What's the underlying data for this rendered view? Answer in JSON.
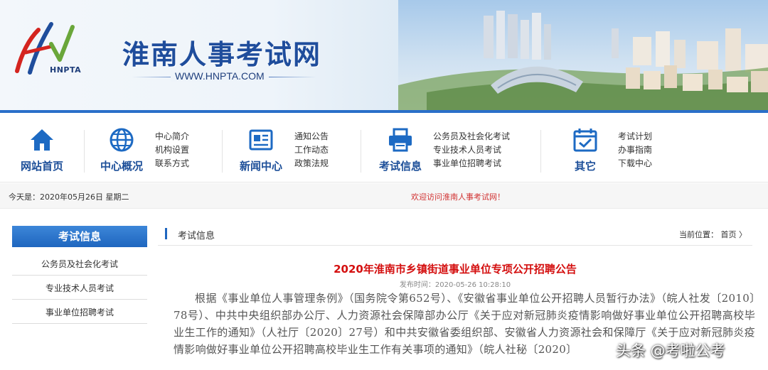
{
  "header": {
    "logo_text": "HNPTA",
    "site_title": "淮南人事考试网",
    "site_url": "WWW.HNPTA.COM"
  },
  "nav": {
    "items": [
      {
        "label": "网站首页",
        "icon": "home-icon"
      },
      {
        "label": "中心概况",
        "icon": "globe-icon",
        "links": [
          "中心简介",
          "机构设置",
          "联系方式"
        ]
      },
      {
        "label": "新闻中心",
        "icon": "news-icon",
        "links": [
          "通知公告",
          "工作动态",
          "政策法规"
        ]
      },
      {
        "label": "考试信息",
        "icon": "printer-icon",
        "links": [
          "公务员及社会化考试",
          "专业技术人员考试",
          "事业单位招聘考试"
        ]
      },
      {
        "label": "其它",
        "icon": "calendar-check-icon",
        "links": [
          "考试计划",
          "办事指南",
          "下载中心"
        ]
      }
    ]
  },
  "strip": {
    "date": "今天是：2020年05月26日 星期二",
    "welcome": "欢迎访问淮南人事考试网！"
  },
  "sidebar": {
    "title": "考试信息",
    "items": [
      "公务员及社会化考试",
      "专业技术人员考试",
      "事业单位招聘考试"
    ]
  },
  "main": {
    "section_title": "考试信息",
    "breadcrumb_prefix": "当前位置：",
    "breadcrumb_home": "首页",
    "breadcrumb_sep": "〉",
    "article_title": "2020年淮南市乡镇街道事业单位专项公开招聘公告",
    "article_meta": "发布时间：2020-05-26 10:28:10",
    "article_body": "根据《事业单位人事管理条例》（国务院令第652号）、《安徽省事业单位公开招聘人员暂行办法》（皖人社发〔2010〕78号）、中共中央组织部办公厅、人力资源社会保障部办公厅《关于应对新冠肺炎疫情影响做好事业单位公开招聘高校毕业生工作的通知》（人社厅〔2020〕27号）和中共安徽省委组织部、安徽省人力资源社会和保障厅《关于应对新冠肺炎疫情影响做好事业单位公开招聘高校毕业生工作有关事项的通知》（皖人社秘〔2020〕"
  },
  "watermark": "头条 @考啦公考",
  "colors": {
    "brand_blue": "#1f66bf",
    "title_red": "#d40f0f",
    "welcome_red": "#d13232"
  }
}
